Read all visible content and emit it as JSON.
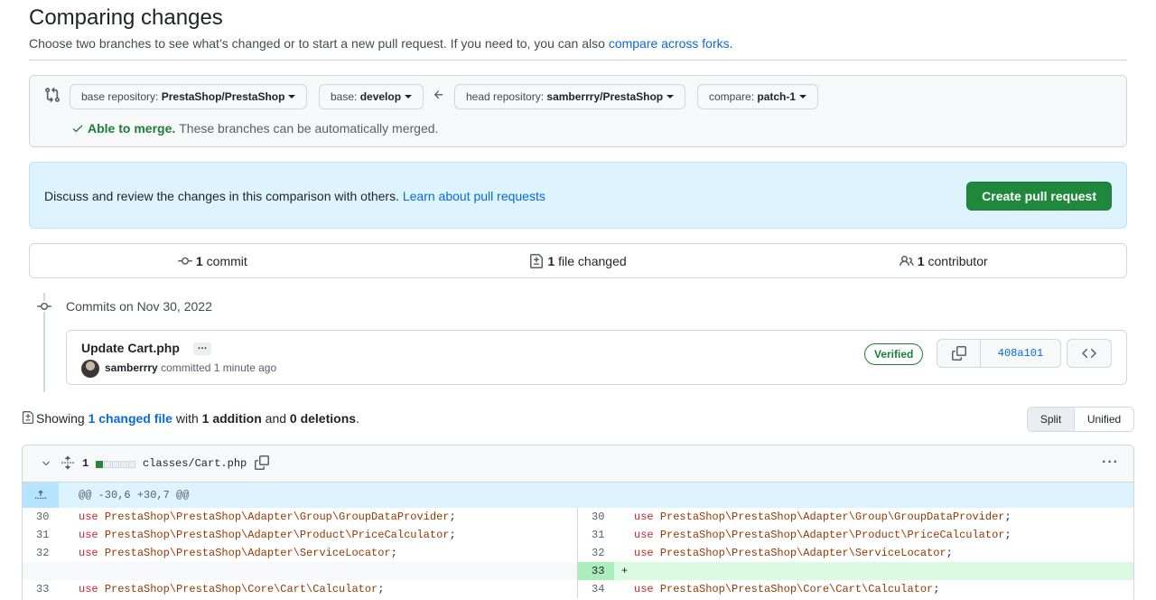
{
  "header": {
    "title": "Comparing changes",
    "subtitle_text": "Choose two branches to see what’s changed or to start a new pull request. If you need to, you can also ",
    "subtitle_link": "compare across forks",
    "subtitle_end": "."
  },
  "range": {
    "base_repo_label": "base repository:",
    "base_repo_value": "PrestaShop/PrestaShop",
    "base_label": "base:",
    "base_value": "develop",
    "head_repo_label": "head repository:",
    "head_repo_value": "samberrry/PrestaShop",
    "compare_label": "compare:",
    "compare_value": "patch-1",
    "merge_ok": "Able to merge.",
    "merge_text": "These branches can be automatically merged."
  },
  "banner": {
    "text": "Discuss and review the changes in this comparison with others. ",
    "link": "Learn about pull requests",
    "button": "Create pull request"
  },
  "summary": {
    "commits_count": "1",
    "commits_label": "commit",
    "files_count": "1",
    "files_label": "file changed",
    "contributors_count": "1",
    "contributors_label": "contributor"
  },
  "commits": {
    "date_heading": "Commits on Nov 30, 2022",
    "items": [
      {
        "title": "Update Cart.php",
        "ellipsis": "…",
        "author": "samberrry",
        "meta": "committed 1 minute ago",
        "verified": "Verified",
        "sha": "408a101"
      }
    ]
  },
  "files_summary": {
    "showing": "Showing ",
    "changed_link": "1 changed file",
    "with": " with ",
    "additions": "1 addition",
    "and": " and ",
    "deletions": "0 deletions",
    "end": ".",
    "split": "Split",
    "unified": "Unified"
  },
  "diff": {
    "changes": "1",
    "file_path": "classes/Cart.php",
    "hunk_header": "@@ -30,6 +30,7 @@",
    "rows": [
      {
        "left_ln": "30",
        "left_code": [
          "use",
          " ",
          "PrestaShop\\PrestaShop\\Adapter\\Group\\GroupDataProvider",
          ";"
        ],
        "right_ln": "30",
        "right_code": [
          "use",
          " ",
          "PrestaShop\\PrestaShop\\Adapter\\Group\\GroupDataProvider",
          ";"
        ]
      },
      {
        "left_ln": "31",
        "left_code": [
          "use",
          " ",
          "PrestaShop\\PrestaShop\\Adapter\\Product\\PriceCalculator",
          ";"
        ],
        "right_ln": "31",
        "right_code": [
          "use",
          " ",
          "PrestaShop\\PrestaShop\\Adapter\\Product\\PriceCalculator",
          ";"
        ]
      },
      {
        "left_ln": "32",
        "left_code": [
          "use",
          " ",
          "PrestaShop\\PrestaShop\\Adapter\\ServiceLocator",
          ";"
        ],
        "right_ln": "32",
        "right_code": [
          "use",
          " ",
          "PrestaShop\\PrestaShop\\Adapter\\ServiceLocator",
          ";"
        ]
      },
      {
        "left_ln": "",
        "left_code": null,
        "right_ln": "33",
        "right_code": [
          "",
          "",
          "",
          ""
        ],
        "added": true,
        "plus": "+"
      },
      {
        "left_ln": "33",
        "left_code": [
          "use",
          " ",
          "PrestaShop\\PrestaShop\\Core\\Cart\\Calculator",
          ";"
        ],
        "right_ln": "34",
        "right_code": [
          "use",
          " ",
          "PrestaShop\\PrestaShop\\Core\\Cart\\Calculator",
          ";"
        ]
      }
    ]
  },
  "colors": {
    "accent": "#0969da",
    "success": "#1a7f37",
    "primary_button": "#1f883d",
    "banner_bg": "#ddf4ff"
  },
  "icons": [
    "git-compare-icon",
    "check-icon",
    "arrow-left-icon",
    "commit-icon",
    "file-diff-icon",
    "people-icon",
    "copy-icon",
    "code-icon",
    "chevron-down-icon",
    "unfold-icon",
    "kebab-horizontal-icon",
    "fold-up-icon"
  ]
}
